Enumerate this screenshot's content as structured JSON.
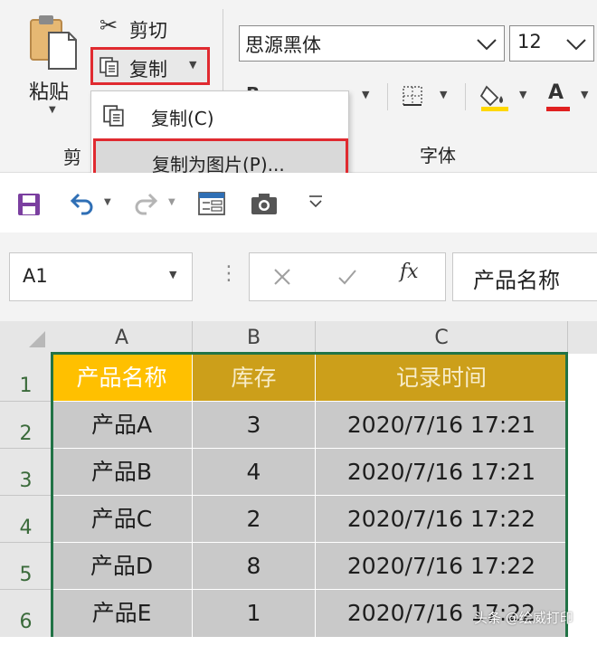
{
  "ribbon": {
    "paste_label": "粘贴",
    "cut_label": "剪切",
    "copy_label": "复制",
    "font_name": "思源黑体",
    "font_size": "12",
    "clipboard_group_label": "剪",
    "font_group_label": "字体",
    "bold_glyph": "B",
    "font_color_glyph": "A",
    "fill_color": "#ffd800",
    "font_color_bar": "#e02020"
  },
  "copy_menu": {
    "items": [
      {
        "label": "复制(C)"
      },
      {
        "label": "复制为图片(P)..."
      }
    ]
  },
  "formula_bar": {
    "name_box": "A1",
    "fx_label": "fx",
    "formula_text": "产品名称"
  },
  "sheet": {
    "columns": [
      "A",
      "B",
      "C"
    ],
    "rows": [
      "1",
      "2",
      "3",
      "4",
      "5",
      "6"
    ],
    "header_row": [
      "产品名称",
      "库存",
      "记录时间"
    ],
    "data": [
      [
        "产品A",
        "3",
        "2020/7/16 17:21"
      ],
      [
        "产品B",
        "4",
        "2020/7/16 17:21"
      ],
      [
        "产品C",
        "2",
        "2020/7/16 17:22"
      ],
      [
        "产品D",
        "8",
        "2020/7/16 17:22"
      ],
      [
        "产品E",
        "1",
        "2020/7/16 17:22"
      ]
    ],
    "accent_header_a": "#ffc000",
    "accent_header_bc": "#cc9f1a",
    "selection_color": "#217346"
  },
  "watermark": "头条 @绘威打印"
}
